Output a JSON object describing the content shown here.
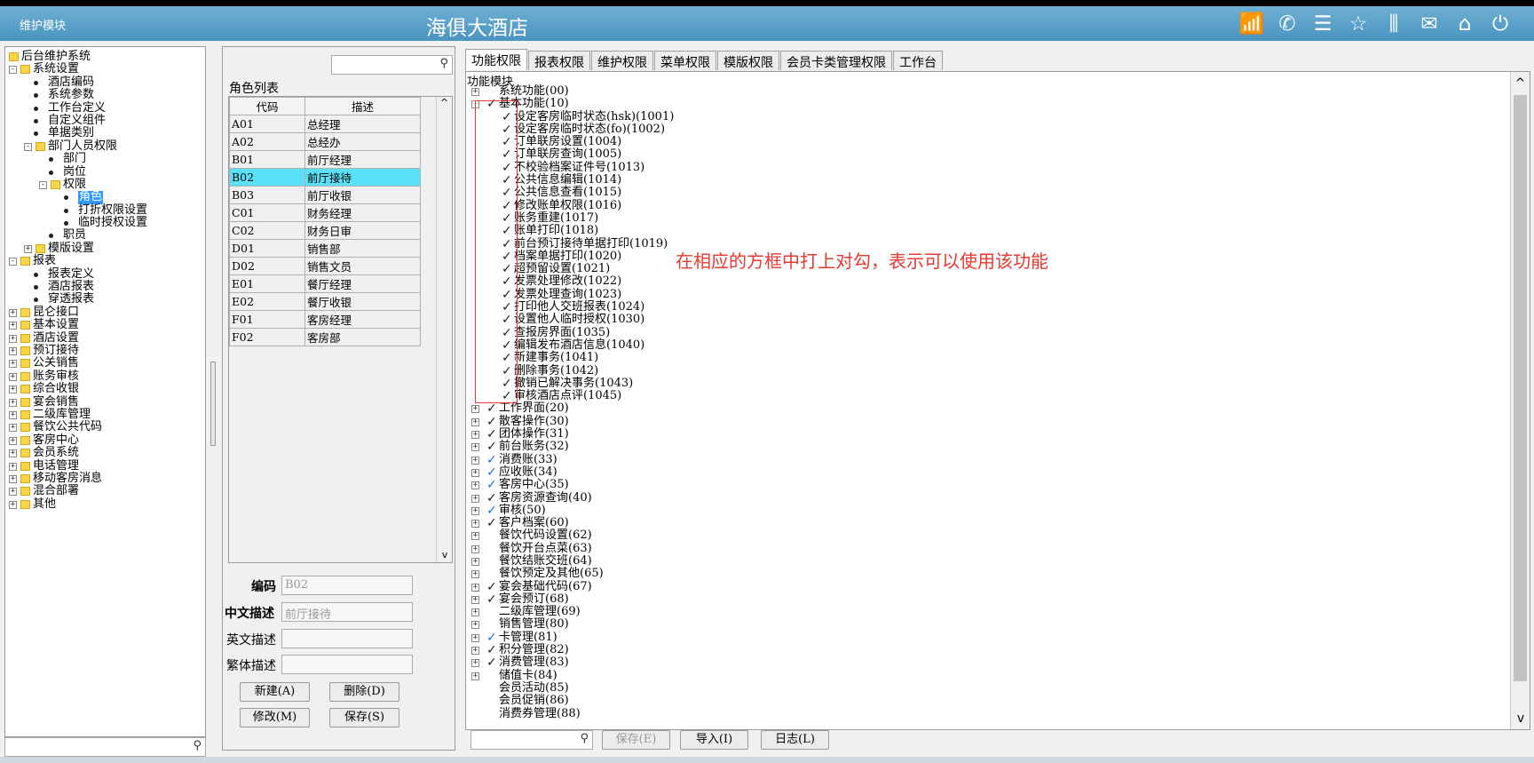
{
  "window": {
    "left_title": "维护模块",
    "center_title": "海俱大酒店",
    "icons": [
      "signal-icon",
      "phone-icon",
      "menu-icon",
      "star-icon",
      "columns-icon",
      "mail-icon",
      "home-icon",
      "power-icon"
    ]
  },
  "left_tree": [
    {
      "label": "后台维护系统",
      "depth": 0,
      "kind": "folder-root"
    },
    {
      "label": "系统设置",
      "depth": 1,
      "kind": "folder-open"
    },
    {
      "label": "酒店编码",
      "depth": 2,
      "kind": "leaf"
    },
    {
      "label": "系统参数",
      "depth": 2,
      "kind": "leaf"
    },
    {
      "label": "工作台定义",
      "depth": 2,
      "kind": "leaf"
    },
    {
      "label": "自定义组件",
      "depth": 2,
      "kind": "leaf"
    },
    {
      "label": "单据类别",
      "depth": 2,
      "kind": "leaf"
    },
    {
      "label": "部门人员权限",
      "depth": 2,
      "kind": "folder-open"
    },
    {
      "label": "部门",
      "depth": 3,
      "kind": "leaf"
    },
    {
      "label": "岗位",
      "depth": 3,
      "kind": "leaf"
    },
    {
      "label": "权限",
      "depth": 3,
      "kind": "folder-open"
    },
    {
      "label": "角色",
      "depth": 4,
      "kind": "leaf",
      "selected": true
    },
    {
      "label": "打折权限设置",
      "depth": 4,
      "kind": "leaf"
    },
    {
      "label": "临时授权设置",
      "depth": 4,
      "kind": "leaf"
    },
    {
      "label": "职员",
      "depth": 3,
      "kind": "leaf"
    },
    {
      "label": "模版设置",
      "depth": 2,
      "kind": "folder-closed"
    },
    {
      "label": "报表",
      "depth": 1,
      "kind": "folder-open"
    },
    {
      "label": "报表定义",
      "depth": 2,
      "kind": "leaf"
    },
    {
      "label": "酒店报表",
      "depth": 2,
      "kind": "leaf"
    },
    {
      "label": "穿透报表",
      "depth": 2,
      "kind": "leaf"
    },
    {
      "label": "昆仑接口",
      "depth": 1,
      "kind": "folder-closed"
    },
    {
      "label": "基本设置",
      "depth": 1,
      "kind": "folder-closed"
    },
    {
      "label": "酒店设置",
      "depth": 1,
      "kind": "folder-closed"
    },
    {
      "label": "预订接待",
      "depth": 1,
      "kind": "folder-closed"
    },
    {
      "label": "公关销售",
      "depth": 1,
      "kind": "folder-closed"
    },
    {
      "label": "账务审核",
      "depth": 1,
      "kind": "folder-closed"
    },
    {
      "label": "综合收银",
      "depth": 1,
      "kind": "folder-closed"
    },
    {
      "label": "宴会销售",
      "depth": 1,
      "kind": "folder-closed"
    },
    {
      "label": "二级库管理",
      "depth": 1,
      "kind": "folder-closed"
    },
    {
      "label": "餐饮公共代码",
      "depth": 1,
      "kind": "folder-closed"
    },
    {
      "label": "客房中心",
      "depth": 1,
      "kind": "folder-closed"
    },
    {
      "label": "会员系统",
      "depth": 1,
      "kind": "folder-closed"
    },
    {
      "label": "电话管理",
      "depth": 1,
      "kind": "folder-closed"
    },
    {
      "label": "移动客房消息",
      "depth": 1,
      "kind": "folder-closed"
    },
    {
      "label": "混合部署",
      "depth": 1,
      "kind": "folder-closed"
    },
    {
      "label": "其他",
      "depth": 1,
      "kind": "folder-closed"
    }
  ],
  "roles": {
    "title": "角色列表",
    "col_code": "代码",
    "col_desc": "描述",
    "rows": [
      {
        "code": "A01",
        "desc": "总经理"
      },
      {
        "code": "A02",
        "desc": "总经办"
      },
      {
        "code": "B01",
        "desc": "前厅经理"
      },
      {
        "code": "B02",
        "desc": "前厅接待",
        "selected": true
      },
      {
        "code": "B03",
        "desc": "前厅收银"
      },
      {
        "code": "C01",
        "desc": "财务经理"
      },
      {
        "code": "C02",
        "desc": "财务日审"
      },
      {
        "code": "D01",
        "desc": "销售部"
      },
      {
        "code": "D02",
        "desc": "销售文员"
      },
      {
        "code": "E01",
        "desc": "餐厅经理"
      },
      {
        "code": "E02",
        "desc": "餐厅收银"
      },
      {
        "code": "F01",
        "desc": "客房经理"
      },
      {
        "code": "F02",
        "desc": "客房部"
      }
    ]
  },
  "form": {
    "code_label": "编码",
    "code_value": "B02",
    "cn_label": "中文描述",
    "cn_value": "前厅接待",
    "en_label": "英文描述",
    "en_value": "",
    "tw_label": "繁体描述",
    "tw_value": "",
    "new_btn": "新建(A)",
    "delete_btn": "删除(D)",
    "modify_btn": "修改(M)",
    "save_btn": "保存(S)"
  },
  "tabs": [
    "功能权限",
    "报表权限",
    "维护权限",
    "菜单权限",
    "模版权限",
    "会员卡类管理权限",
    "工作台"
  ],
  "function_module_label": "功能模块",
  "annotation": "在相应的方框中打上对勾，表示可以使用该功能",
  "functions": [
    {
      "label": "系统功能(00)",
      "expander": "+",
      "check": "none",
      "indent": 0
    },
    {
      "label": "基本功能(10)",
      "expander": "-",
      "check": "black",
      "indent": 0
    },
    {
      "label": "设定客房临时状态(hsk)(1001)",
      "check": "black",
      "indent": 1
    },
    {
      "label": "设定客房临时状态(fo)(1002)",
      "check": "black",
      "indent": 1
    },
    {
      "label": "订单联房设置(1004)",
      "check": "black",
      "indent": 1
    },
    {
      "label": "订单联房查询(1005)",
      "check": "black",
      "indent": 1
    },
    {
      "label": "不校验档案证件号(1013)",
      "check": "black",
      "indent": 1
    },
    {
      "label": "公共信息编辑(1014)",
      "check": "black",
      "indent": 1
    },
    {
      "label": "公共信息查看(1015)",
      "check": "black",
      "indent": 1
    },
    {
      "label": "修改账单权限(1016)",
      "check": "black",
      "indent": 1
    },
    {
      "label": "账务重建(1017)",
      "check": "black",
      "indent": 1
    },
    {
      "label": "账单打印(1018)",
      "check": "black",
      "indent": 1
    },
    {
      "label": "前台预订接待单据打印(1019)",
      "check": "black",
      "indent": 1
    },
    {
      "label": "档案单据打印(1020)",
      "check": "black",
      "indent": 1
    },
    {
      "label": "超预留设置(1021)",
      "check": "black",
      "indent": 1
    },
    {
      "label": "发票处理修改(1022)",
      "check": "black",
      "indent": 1
    },
    {
      "label": "发票处理查询(1023)",
      "check": "black",
      "indent": 1
    },
    {
      "label": "打印他人交班报表(1024)",
      "check": "black",
      "indent": 1
    },
    {
      "label": "设置他人临时授权(1030)",
      "check": "black",
      "indent": 1
    },
    {
      "label": "查报房界面(1035)",
      "check": "black",
      "indent": 1
    },
    {
      "label": "编辑发布酒店信息(1040)",
      "check": "black",
      "indent": 1
    },
    {
      "label": "新建事务(1041)",
      "check": "black",
      "indent": 1
    },
    {
      "label": "删除事务(1042)",
      "check": "black",
      "indent": 1
    },
    {
      "label": "撤销已解决事务(1043)",
      "check": "black",
      "indent": 1
    },
    {
      "label": "审核酒店点评(1045)",
      "check": "black",
      "indent": 1
    },
    {
      "label": "工作界面(20)",
      "expander": "+",
      "check": "black",
      "indent": 0
    },
    {
      "label": "散客操作(30)",
      "expander": "+",
      "check": "black",
      "indent": 0
    },
    {
      "label": "团体操作(31)",
      "expander": "+",
      "check": "black",
      "indent": 0
    },
    {
      "label": "前台账务(32)",
      "expander": "+",
      "check": "black",
      "indent": 0
    },
    {
      "label": "消费账(33)",
      "expander": "+",
      "check": "blue",
      "indent": 0
    },
    {
      "label": "应收账(34)",
      "expander": "+",
      "check": "blue",
      "indent": 0
    },
    {
      "label": "客房中心(35)",
      "expander": "+",
      "check": "blue",
      "indent": 0
    },
    {
      "label": "客房资源查询(40)",
      "expander": "+",
      "check": "black",
      "indent": 0
    },
    {
      "label": "审核(50)",
      "expander": "+",
      "check": "blue",
      "indent": 0
    },
    {
      "label": "客户档案(60)",
      "expander": "+",
      "check": "black",
      "indent": 0
    },
    {
      "label": "餐饮代码设置(62)",
      "expander": "+",
      "check": "none",
      "indent": 0
    },
    {
      "label": "餐饮开台点菜(63)",
      "expander": "+",
      "check": "none",
      "indent": 0
    },
    {
      "label": "餐饮结账交班(64)",
      "expander": "+",
      "check": "none",
      "indent": 0
    },
    {
      "label": "餐饮预定及其他(65)",
      "expander": "+",
      "check": "none",
      "indent": 0
    },
    {
      "label": "宴会基础代码(67)",
      "expander": "+",
      "check": "black",
      "indent": 0
    },
    {
      "label": "宴会预订(68)",
      "expander": "+",
      "check": "black",
      "indent": 0
    },
    {
      "label": "二级库管理(69)",
      "expander": "+",
      "check": "none",
      "indent": 0
    },
    {
      "label": "销售管理(80)",
      "expander": "+",
      "check": "none",
      "indent": 0
    },
    {
      "label": "卡管理(81)",
      "expander": "+",
      "check": "blue",
      "indent": 0
    },
    {
      "label": "积分管理(82)",
      "expander": "+",
      "check": "black",
      "indent": 0
    },
    {
      "label": "消费管理(83)",
      "expander": "+",
      "check": "black",
      "indent": 0
    },
    {
      "label": "储值卡(84)",
      "expander": "+",
      "check": "none",
      "indent": 0
    },
    {
      "label": "会员活动(85)",
      "expander": "",
      "check": "none",
      "indent": 0
    },
    {
      "label": "会员促销(86)",
      "expander": "",
      "check": "none",
      "indent": 0
    },
    {
      "label": "消费券管理(88)",
      "expander": "",
      "check": "none",
      "indent": 0
    }
  ],
  "bottom_bar": {
    "save_btn": "保存(E)",
    "import_btn": "导入(I)",
    "log_btn": "日志(L)"
  },
  "colors": {
    "title_bar": "#5aa3cc",
    "selected_row": "#5be1f7",
    "tree_selection": "#3399ff",
    "annotation": "#e8382f"
  }
}
